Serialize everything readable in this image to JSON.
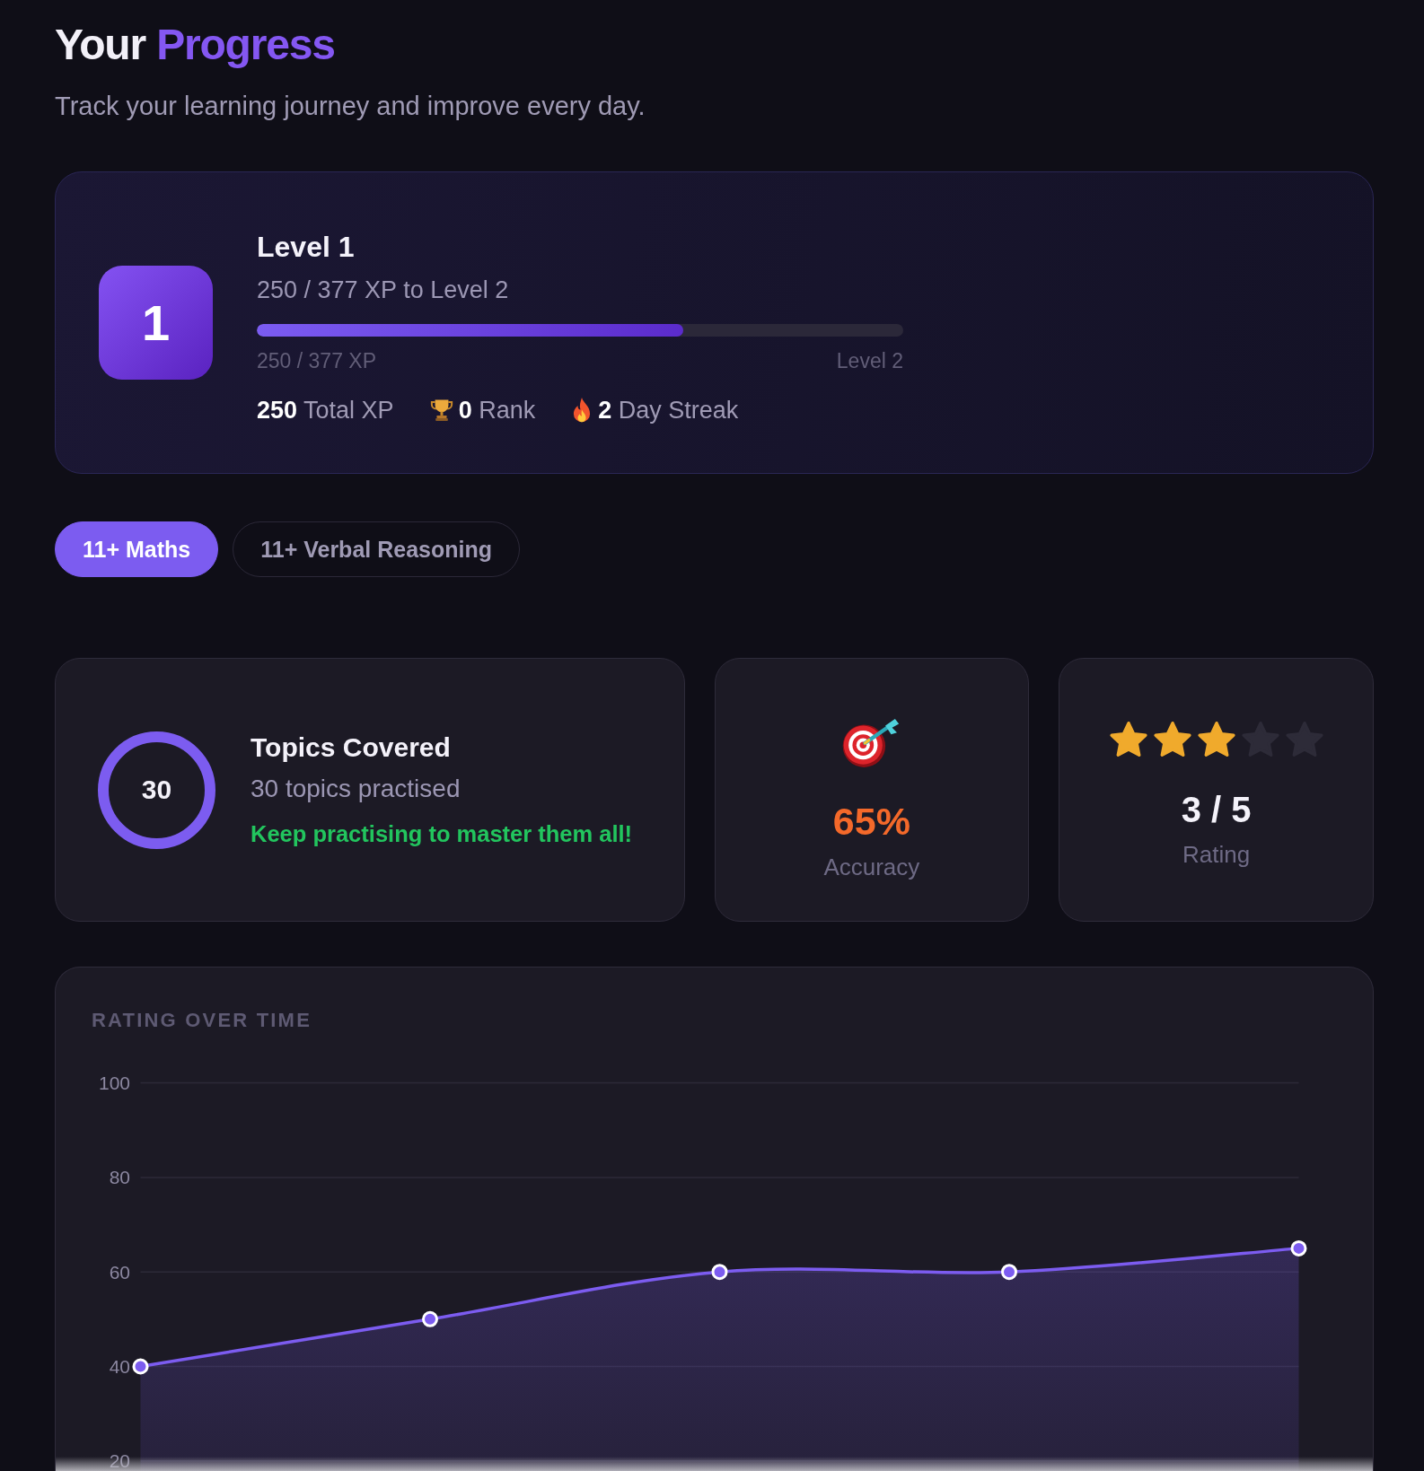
{
  "header": {
    "title": "Your",
    "title_highlight": "Progress",
    "subtitle": "Track your learning journey and improve every day."
  },
  "level_card": {
    "badge": "1",
    "title": "Level 1",
    "subtitle": "250 / 377 XP to Level 2",
    "level": 0.66,
    "bar_start": "250 / 377 XP",
    "bar_end": "Level 2",
    "stats": [
      {
        "kind": "total",
        "text": "**250** Total XP"
      },
      {
        "kind": "rank",
        "text": "**0** Rank"
      },
      {
        "kind": "streak",
        "text": "**2** Day Streak"
      }
    ]
  },
  "tabs": [
    {
      "label": "11+ Maths",
      "selected": true
    },
    {
      "label": "11+ Verbal Reasoning",
      "selected": false
    }
  ],
  "stat_cards": [
    {
      "kind": "topics",
      "count": "30",
      "title": "Topics Covered",
      "detail": "30 topics practised",
      "note": "Keep practising to master them all!"
    },
    {
      "kind": "accuracy",
      "value": "65%",
      "label": "Accuracy"
    },
    {
      "kind": "rating",
      "stars": 3,
      "value": "3 / 5",
      "label": "Rating"
    }
  ],
  "rating_chart": {
    "chart_data": {
      "type": "area",
      "title": "RATING OVER TIME",
      "grid": true,
      "ylim": [
        0,
        100
      ],
      "yticks": [
        20,
        40,
        60,
        80,
        100
      ],
      "series": [
        {
          "color": "#7c5cf0",
          "values": [
            40,
            50,
            60,
            60,
            65
          ]
        }
      ]
    }
  }
}
